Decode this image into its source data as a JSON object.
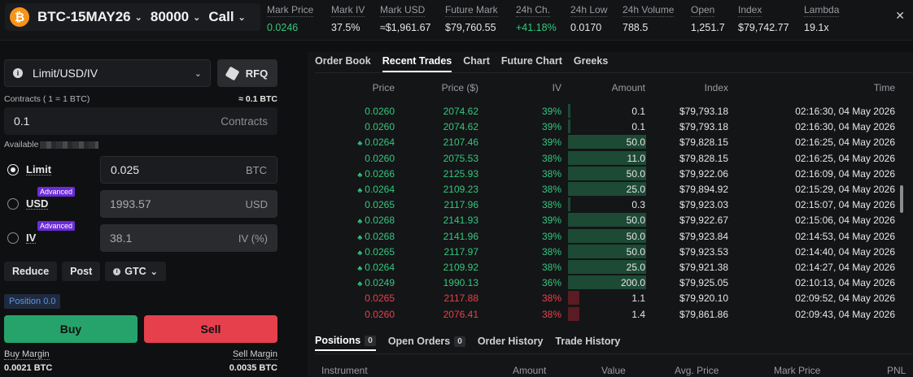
{
  "header": {
    "underlying": "BTC-15MAY26",
    "strike": "80000",
    "option_type": "Call",
    "stats": [
      {
        "label": "Mark Price",
        "value": "0.0246",
        "color": "green"
      },
      {
        "label": "Mark IV",
        "value": "37.5%",
        "color": ""
      },
      {
        "label": "Mark USD",
        "value": "≈$1,961.67",
        "color": ""
      },
      {
        "label": "Future Mark",
        "value": "$79,760.55",
        "color": ""
      },
      {
        "label": "24h Ch.",
        "value": "+41.18%",
        "color": "green"
      },
      {
        "label": "24h Low",
        "value": "0.0170",
        "color": ""
      },
      {
        "label": "24h Volume",
        "value": "788.5",
        "color": ""
      },
      {
        "label": "Open",
        "value": "1,251.7",
        "color": ""
      },
      {
        "label": "Index",
        "value": "$79,742.77",
        "color": ""
      },
      {
        "label": "Lambda",
        "value": "19.1x",
        "color": ""
      }
    ],
    "close_glyph": "✕"
  },
  "order_form": {
    "order_type": "Limit/USD/IV",
    "rfq_label": "RFQ",
    "contracts_label": "Contracts ( 1 = 1 BTC)",
    "contracts_equiv": "≈ 0.1 BTC",
    "quantity": {
      "value": "0.1",
      "unit": "Contracts"
    },
    "available_label": "Available",
    "advanced_badge": "Advanced",
    "price_modes": [
      {
        "label": "Limit",
        "value": "0.025",
        "unit": "BTC",
        "selected": true
      },
      {
        "label": "USD",
        "value": "1993.57",
        "unit": "USD",
        "selected": false
      },
      {
        "label": "IV",
        "value": "38.1",
        "unit": "IV (%)",
        "selected": false
      }
    ],
    "reduce_label": "Reduce",
    "post_label": "Post",
    "tif_label": "GTC",
    "position_label": "Position 0.0",
    "buy_label": "Buy",
    "sell_label": "Sell",
    "buy_margin_label": "Buy Margin",
    "buy_margin_value": "0.0021 BTC",
    "sell_margin_label": "Sell Margin",
    "sell_margin_value": "0.0035 BTC"
  },
  "tabs": [
    "Order Book",
    "Recent Trades",
    "Chart",
    "Future Chart",
    "Greeks"
  ],
  "active_tab": 1,
  "trades": {
    "columns": [
      "Price",
      "Price ($)",
      "IV",
      "Amount",
      "Index",
      "Time"
    ],
    "rows": [
      {
        "price": "0.0260",
        "usd": "2074.62",
        "iv": "39%",
        "amount": "0.1",
        "amount_level": 0.1,
        "index": "$79,793.18",
        "time": "02:16:30, 04 May 2026",
        "side": "buy",
        "tick": false
      },
      {
        "price": "0.0260",
        "usd": "2074.62",
        "iv": "39%",
        "amount": "0.1",
        "amount_level": 0.1,
        "index": "$79,793.18",
        "time": "02:16:30, 04 May 2026",
        "side": "buy",
        "tick": false
      },
      {
        "price": "0.0264",
        "usd": "2107.46",
        "iv": "39%",
        "amount": "50.0",
        "amount_level": 50.0,
        "index": "$79,828.15",
        "time": "02:16:25, 04 May 2026",
        "side": "buy",
        "tick": true
      },
      {
        "price": "0.0260",
        "usd": "2075.53",
        "iv": "38%",
        "amount": "11.0",
        "amount_level": 11.0,
        "index": "$79,828.15",
        "time": "02:16:25, 04 May 2026",
        "side": "buy",
        "tick": false
      },
      {
        "price": "0.0266",
        "usd": "2125.93",
        "iv": "38%",
        "amount": "50.0",
        "amount_level": 50.0,
        "index": "$79,922.06",
        "time": "02:16:09, 04 May 2026",
        "side": "buy",
        "tick": true
      },
      {
        "price": "0.0264",
        "usd": "2109.23",
        "iv": "38%",
        "amount": "25.0",
        "amount_level": 25.0,
        "index": "$79,894.92",
        "time": "02:15:29, 04 May 2026",
        "side": "buy",
        "tick": true
      },
      {
        "price": "0.0265",
        "usd": "2117.96",
        "iv": "38%",
        "amount": "0.3",
        "amount_level": 0.3,
        "index": "$79,923.03",
        "time": "02:15:07, 04 May 2026",
        "side": "buy",
        "tick": false
      },
      {
        "price": "0.0268",
        "usd": "2141.93",
        "iv": "39%",
        "amount": "50.0",
        "amount_level": 50.0,
        "index": "$79,922.67",
        "time": "02:15:06, 04 May 2026",
        "side": "buy",
        "tick": true
      },
      {
        "price": "0.0268",
        "usd": "2141.96",
        "iv": "39%",
        "amount": "50.0",
        "amount_level": 50.0,
        "index": "$79,923.84",
        "time": "02:14:53, 04 May 2026",
        "side": "buy",
        "tick": true
      },
      {
        "price": "0.0265",
        "usd": "2117.97",
        "iv": "38%",
        "amount": "50.0",
        "amount_level": 50.0,
        "index": "$79,923.53",
        "time": "02:14:40, 04 May 2026",
        "side": "buy",
        "tick": true
      },
      {
        "price": "0.0264",
        "usd": "2109.92",
        "iv": "38%",
        "amount": "25.0",
        "amount_level": 25.0,
        "index": "$79,921.38",
        "time": "02:14:27, 04 May 2026",
        "side": "buy",
        "tick": true
      },
      {
        "price": "0.0249",
        "usd": "1990.13",
        "iv": "36%",
        "amount": "200.0",
        "amount_level": 200.0,
        "index": "$79,925.05",
        "time": "02:10:13, 04 May 2026",
        "side": "buy",
        "tick": true
      },
      {
        "price": "0.0265",
        "usd": "2117.88",
        "iv": "38%",
        "amount": "1.1",
        "amount_level": 1.1,
        "index": "$79,920.10",
        "time": "02:09:52, 04 May 2026",
        "side": "sell",
        "tick": false
      },
      {
        "price": "0.0260",
        "usd": "2076.41",
        "iv": "38%",
        "amount": "1.4",
        "amount_level": 1.4,
        "index": "$79,861.86",
        "time": "02:09:43, 04 May 2026",
        "side": "sell",
        "tick": false
      }
    ]
  },
  "bottom_tabs": [
    {
      "label": "Positions",
      "count": "0"
    },
    {
      "label": "Open Orders",
      "count": "0"
    },
    {
      "label": "Order History",
      "count": ""
    },
    {
      "label": "Trade History",
      "count": ""
    }
  ],
  "positions_columns": [
    "Instrument",
    "Amount",
    "Value",
    "Avg. Price",
    "Mark Price",
    "PNL"
  ],
  "colors": {
    "buy": "#32c87e",
    "sell": "#e8404d",
    "buy_bar": "#1d4a35",
    "sell_bar": "#5a1c22",
    "accent": "#6c2bd9"
  }
}
